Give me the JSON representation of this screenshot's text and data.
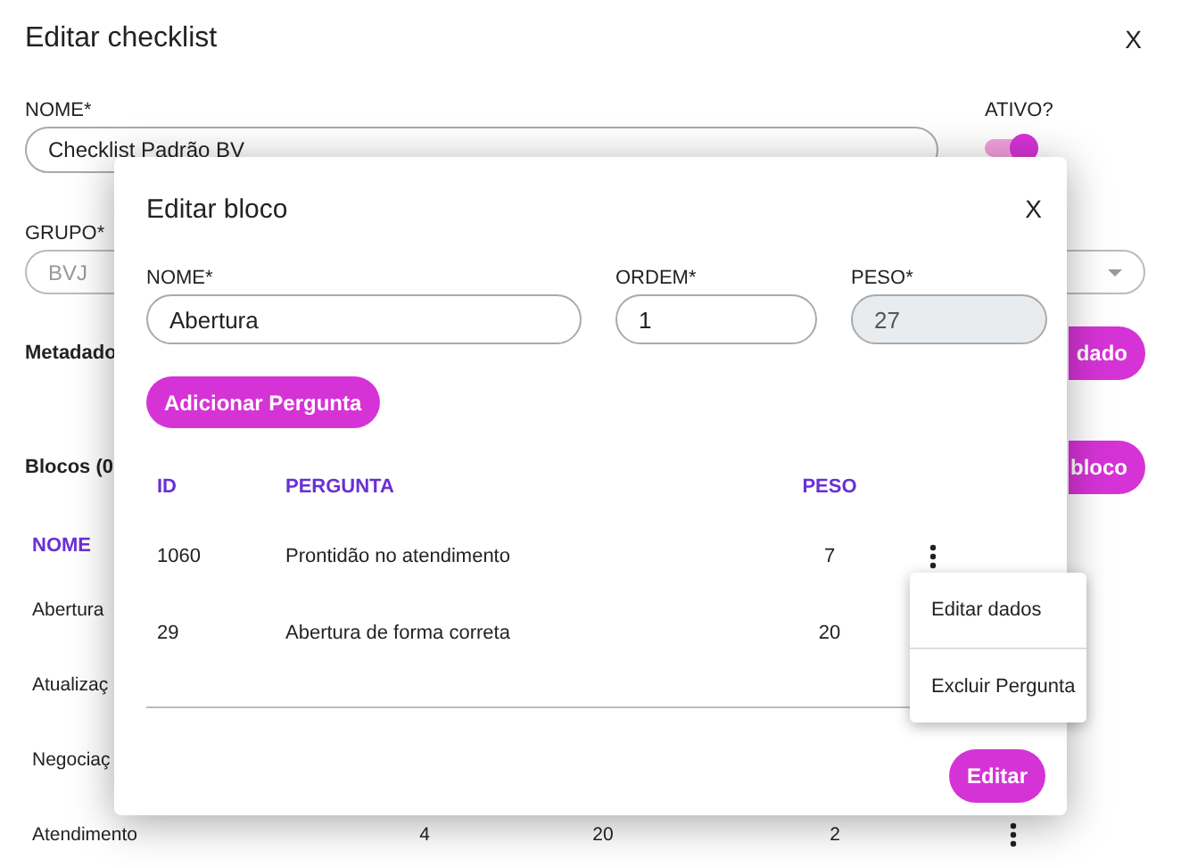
{
  "page": {
    "title": "Editar checklist",
    "close": "X",
    "name_field": {
      "label": "NOME*",
      "value": "Checklist Padrão BV"
    },
    "active": {
      "label": "ATIVO?",
      "on": true
    },
    "group_field": {
      "label": "GRUPO*",
      "value": "BVJ",
      "disabled": true
    },
    "metadata": {
      "heading": "Metadado",
      "button": "dado"
    },
    "blocks": {
      "heading": "Blocos (0",
      "button": "bloco",
      "columns": [
        "NOME"
      ],
      "rows": [
        {
          "name": "Abertura",
          "values": []
        },
        {
          "name": "Atualizaç",
          "values": []
        },
        {
          "name": "Negociaç",
          "values": []
        },
        {
          "name": "Atendimento",
          "values": [
            "4",
            "20",
            "2"
          ]
        }
      ]
    }
  },
  "modal": {
    "title": "Editar bloco",
    "close": "X",
    "fields": [
      {
        "label": "NOME*",
        "value": "Abertura",
        "disabled": false
      },
      {
        "label": "ORDEM*",
        "value": "1",
        "disabled": false
      },
      {
        "label": "PESO*",
        "value": "27",
        "disabled": true
      }
    ],
    "add_button": "Adicionar Pergunta",
    "table": {
      "columns": [
        "ID",
        "PERGUNTA",
        "PESO"
      ],
      "rows": [
        {
          "id": "1060",
          "question": "Prontidão no atendimento",
          "weight": "7",
          "menu": {
            "items": [
              "Editar dados",
              "Excluir Pergunta"
            ]
          }
        },
        {
          "id": "29",
          "question": "Abertura de forma correta",
          "weight": "20"
        }
      ]
    },
    "submit": "Editar"
  }
}
